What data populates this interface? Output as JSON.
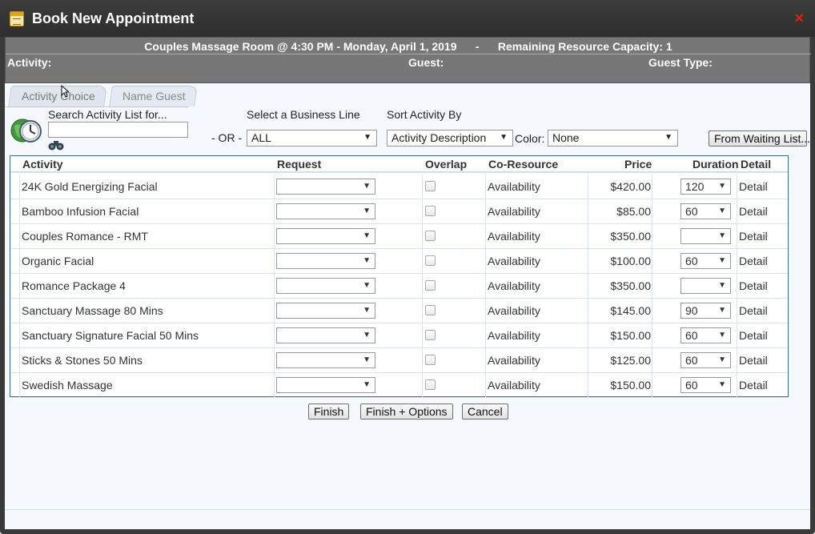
{
  "window": {
    "title": "Book New Appointment",
    "close_label": "×"
  },
  "info": {
    "summary": "Couples Massage Room @ 4:30 PM - Monday, April 1, 2019      -      Remaining Resource Capacity: 1",
    "activity_label": "Activity:",
    "guest_label": "Guest:",
    "guest_type_label": "Guest Type:"
  },
  "tabs": [
    {
      "label": "Activity Choice",
      "active": true
    },
    {
      "label": "Name Guest",
      "active": false
    }
  ],
  "search": {
    "label": "Search Activity List for...",
    "value": "",
    "or_label": "- OR -",
    "business_line_label": "Select a Business Line",
    "business_line_value": "ALL",
    "sort_label": "Sort Activity By",
    "sort_value": "Activity Description",
    "color_label": "Color:",
    "color_value": "None",
    "waiting_list_button": "From Waiting List..."
  },
  "table": {
    "headers": {
      "activity": "Activity",
      "request": "Request",
      "overlap": "Overlap",
      "coresource": "Co-Resource",
      "price": "Price",
      "duration": "Duration",
      "detail": "Detail"
    },
    "rows": [
      {
        "activity": "24K Gold Energizing Facial",
        "request": "",
        "coresource": "Availability",
        "price": "$420.00",
        "duration": "120",
        "detail": "Detail"
      },
      {
        "activity": "Bamboo Infusion Facial",
        "request": "",
        "coresource": "Availability",
        "price": "$85.00",
        "duration": "60",
        "detail": "Detail"
      },
      {
        "activity": "Couples Romance - RMT",
        "request": "",
        "coresource": "Availability",
        "price": "$350.00",
        "duration": "",
        "detail": "Detail"
      },
      {
        "activity": "Organic Facial",
        "request": "",
        "coresource": "Availability",
        "price": "$100.00",
        "duration": "60",
        "detail": "Detail"
      },
      {
        "activity": "Romance Package 4",
        "request": "",
        "coresource": "Availability",
        "price": "$350.00",
        "duration": "",
        "detail": "Detail"
      },
      {
        "activity": "Sanctuary Massage 80 Mins",
        "request": "",
        "coresource": "Availability",
        "price": "$145.00",
        "duration": "90",
        "detail": "Detail"
      },
      {
        "activity": "Sanctuary Signature Facial 50 Mins",
        "request": "",
        "coresource": "Availability",
        "price": "$150.00",
        "duration": "60",
        "detail": "Detail"
      },
      {
        "activity": "Sticks & Stones 50 Mins",
        "request": "",
        "coresource": "Availability",
        "price": "$125.00",
        "duration": "60",
        "detail": "Detail"
      },
      {
        "activity": "Swedish Massage",
        "request": "",
        "coresource": "Availability",
        "price": "$150.00",
        "duration": "60",
        "detail": "Detail"
      }
    ]
  },
  "actions": {
    "finish": "Finish",
    "finish_options": "Finish + Options",
    "cancel": "Cancel"
  },
  "icons": {
    "title": "calendar-icon",
    "close": "close-icon",
    "search": "globe-clock-icon",
    "binoculars": "binoculars-icon",
    "dropdown": "dropdown-arrow-icon"
  },
  "colors": {
    "titlebar": "#333333",
    "infobar": "#777777",
    "close": "#e0220f",
    "grid_border": "#3f6f99"
  }
}
